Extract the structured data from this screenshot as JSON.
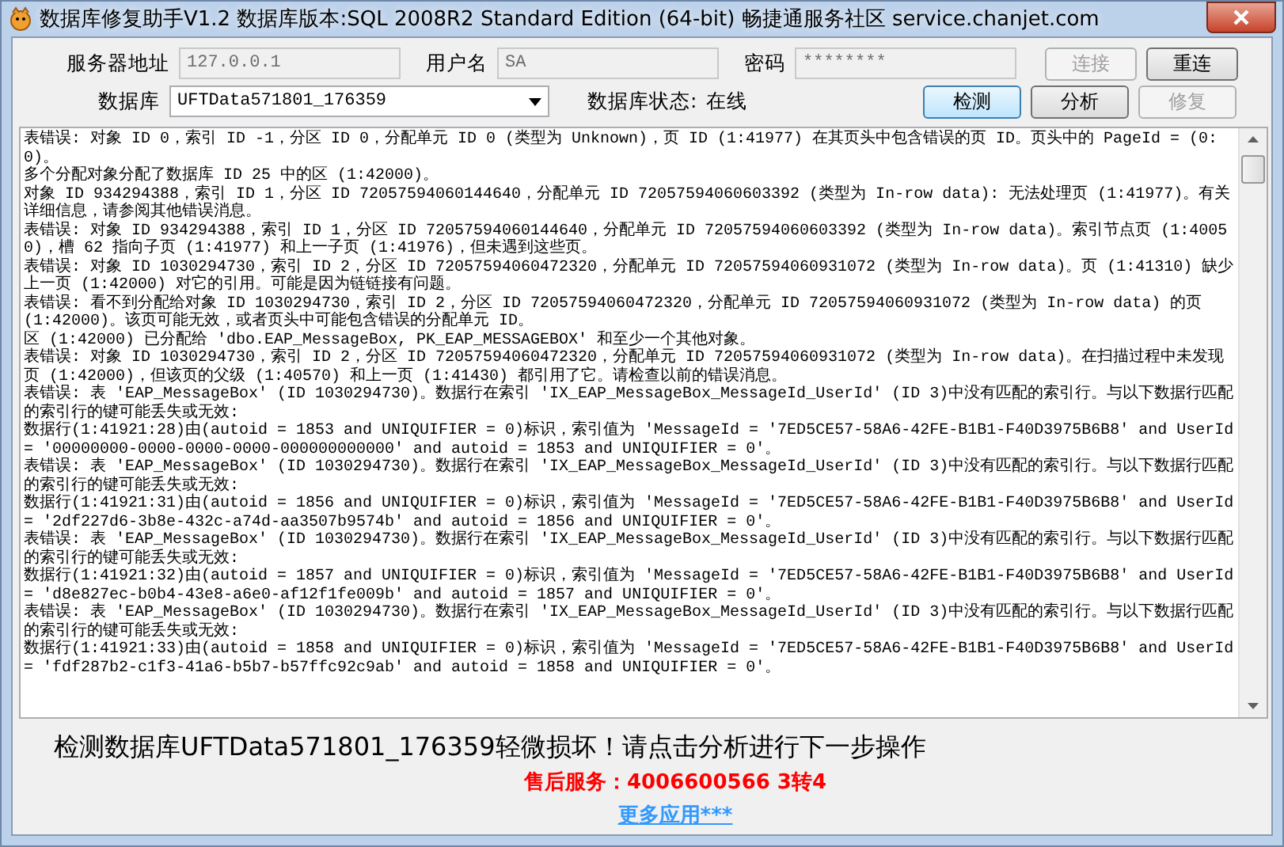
{
  "window": {
    "title": "数据库修复助手V1.2 数据库版本:SQL 2008R2 Standard Edition (64-bit)  畅捷通服务社区 service.chanjet.com"
  },
  "connection": {
    "fields": [
      {
        "label": "服务器地址",
        "value": "127.0.0.1",
        "disabled": true
      },
      {
        "label": "用户名",
        "value": "SA",
        "disabled": true
      },
      {
        "label": "密码",
        "value": "********",
        "disabled": true
      }
    ],
    "buttons": [
      {
        "label": "连接",
        "disabled": true,
        "focused": false
      },
      {
        "label": "重连",
        "disabled": false,
        "focused": false
      }
    ],
    "database_label": "数据库",
    "database_value": "UFTData571801_176359",
    "status_label": "数据库状态:",
    "status_value": "在线",
    "actions": [
      {
        "label": "检测",
        "disabled": false,
        "focused": true
      },
      {
        "label": "分析",
        "disabled": false,
        "focused": false
      },
      {
        "label": "修复",
        "disabled": true,
        "focused": false
      }
    ]
  },
  "log": {
    "lines": [
      "表错误: 对象 ID 0，索引 ID -1，分区 ID 0，分配单元 ID 0 (类型为 Unknown)，页 ID (1:41977) 在其页头中包含错误的页 ID。页头中的 PageId = (0:0)。",
      "多个分配对象分配了数据库 ID 25 中的区 (1:42000)。",
      "对象 ID 934294388，索引 ID 1，分区 ID 72057594060144640，分配单元 ID 72057594060603392 (类型为 In-row data): 无法处理页 (1:41977)。有关详细信息，请参阅其他错误消息。",
      "表错误: 对象 ID 934294388，索引 ID 1，分区 ID 72057594060144640，分配单元 ID 72057594060603392 (类型为 In-row data)。索引节点页 (1:40050)，槽 62 指向子页 (1:41977) 和上一子页 (1:41976)，但未遇到这些页。",
      "表错误: 对象 ID 1030294730，索引 ID 2，分区 ID 72057594060472320，分配单元 ID 72057594060931072 (类型为 In-row data)。页 (1:41310) 缺少上一页 (1:42000) 对它的引用。可能是因为链链接有问题。",
      "表错误: 看不到分配给对象 ID 1030294730，索引 ID 2，分区 ID 72057594060472320，分配单元 ID 72057594060931072 (类型为 In-row data) 的页 (1:42000)。该页可能无效，或者页头中可能包含错误的分配单元 ID。",
      "区 (1:42000) 已分配给 'dbo.EAP_MessageBox, PK_EAP_MESSAGEBOX' 和至少一个其他对象。",
      "表错误: 对象 ID 1030294730，索引 ID 2，分区 ID 72057594060472320，分配单元 ID 72057594060931072 (类型为 In-row data)。在扫描过程中未发现页 (1:42000)，但该页的父级 (1:40570) 和上一页 (1:41430) 都引用了它。请检查以前的错误消息。",
      "表错误: 表 'EAP_MessageBox' (ID 1030294730)。数据行在索引 'IX_EAP_MessageBox_MessageId_UserId' (ID 3)中没有匹配的索引行。与以下数据行匹配的索引行的键可能丢失或无效:",
      "数据行(1:41921:28)由(autoid = 1853 and UNIQUIFIER = 0)标识，索引值为 'MessageId = '7ED5CE57-58A6-42FE-B1B1-F40D3975B6B8' and UserId = '00000000-0000-0000-0000-000000000000' and autoid = 1853 and UNIQUIFIER = 0'。",
      "表错误: 表 'EAP_MessageBox' (ID 1030294730)。数据行在索引 'IX_EAP_MessageBox_MessageId_UserId' (ID 3)中没有匹配的索引行。与以下数据行匹配的索引行的键可能丢失或无效:",
      "数据行(1:41921:31)由(autoid = 1856 and UNIQUIFIER = 0)标识，索引值为 'MessageId = '7ED5CE57-58A6-42FE-B1B1-F40D3975B6B8' and UserId = '2df227d6-3b8e-432c-a74d-aa3507b9574b' and autoid = 1856 and UNIQUIFIER = 0'。",
      "表错误: 表 'EAP_MessageBox' (ID 1030294730)。数据行在索引 'IX_EAP_MessageBox_MessageId_UserId' (ID 3)中没有匹配的索引行。与以下数据行匹配的索引行的键可能丢失或无效:",
      "数据行(1:41921:32)由(autoid = 1857 and UNIQUIFIER = 0)标识，索引值为 'MessageId = '7ED5CE57-58A6-42FE-B1B1-F40D3975B6B8' and UserId = 'd8e827ec-b0b4-43e8-a6e0-af12f1fe009b' and autoid = 1857 and UNIQUIFIER = 0'。",
      "表错误: 表 'EAP_MessageBox' (ID 1030294730)。数据行在索引 'IX_EAP_MessageBox_MessageId_UserId' (ID 3)中没有匹配的索引行。与以下数据行匹配的索引行的键可能丢失或无效:",
      "数据行(1:41921:33)由(autoid = 1858 and UNIQUIFIER = 0)标识，索引值为 'MessageId = '7ED5CE57-58A6-42FE-B1B1-F40D3975B6B8' and UserId = 'fdf287b2-c1f3-41a6-b5b7-b57ffc92c9ab' and autoid = 1858 and UNIQUIFIER = 0'。"
    ]
  },
  "footer": {
    "message": "检测数据库UFTData571801_176359轻微损坏！请点击分析进行下一步操作",
    "service": "售后服务：4006600566 3转4",
    "link": "更多应用***"
  }
}
